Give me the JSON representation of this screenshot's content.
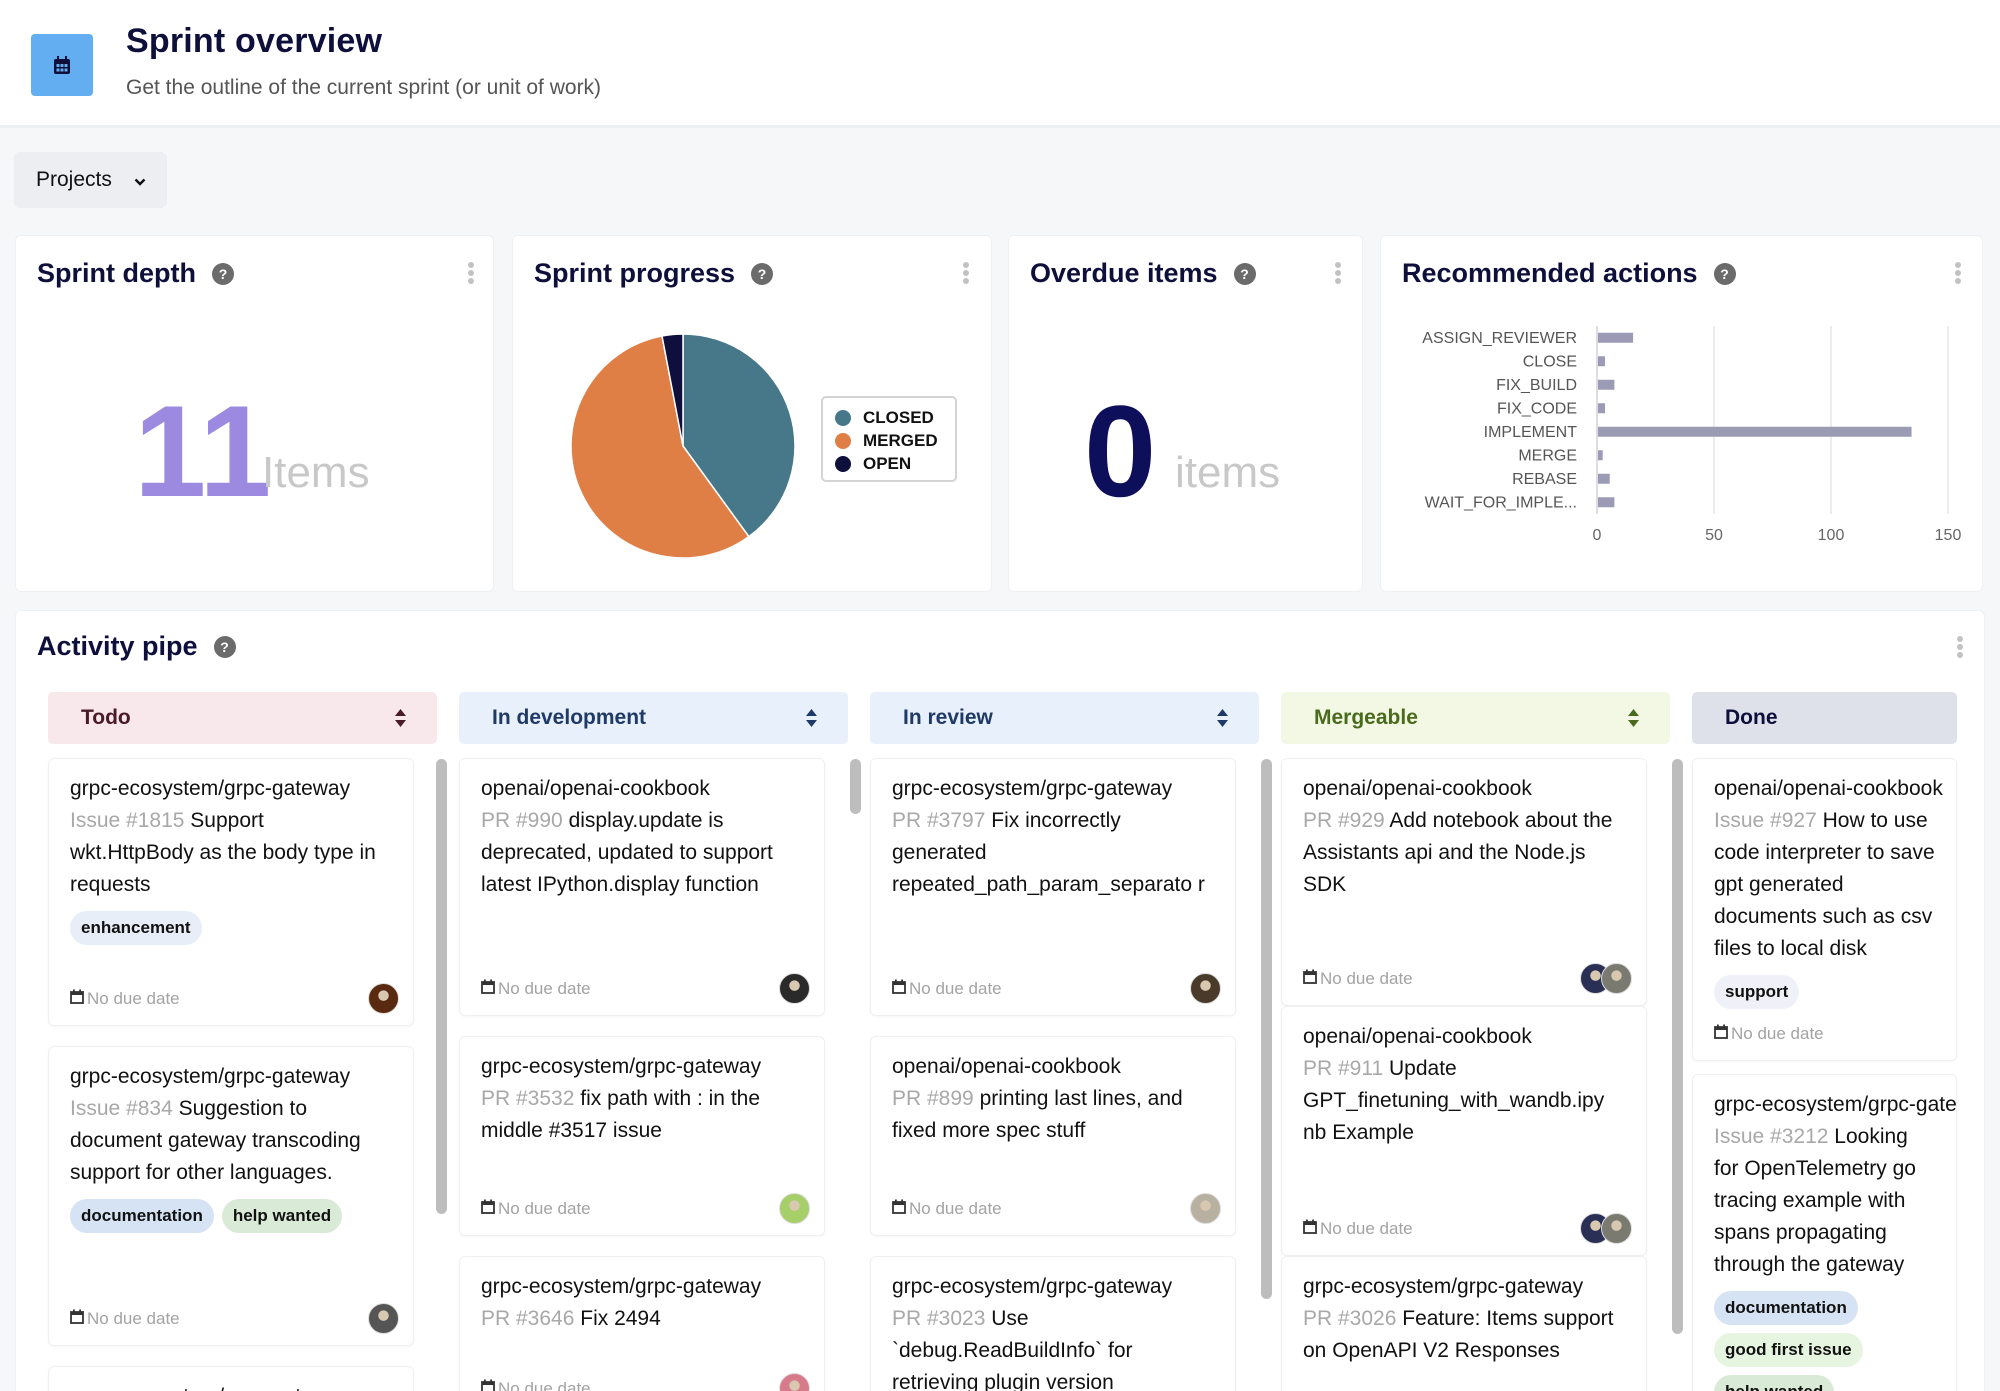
{
  "header": {
    "icon": "calendar-icon",
    "title": "Sprint overview",
    "subtitle": "Get the outline of the current sprint (or unit of work)"
  },
  "filters": {
    "projects_label": "Projects"
  },
  "widgets": {
    "sprint_depth": {
      "title": "Sprint depth",
      "value": "11",
      "unit": "Items"
    },
    "sprint_progress": {
      "title": "Sprint progress"
    },
    "overdue": {
      "title": "Overdue items",
      "value": "0",
      "unit": "items"
    },
    "recommended": {
      "title": "Recommended actions"
    }
  },
  "chart_data": [
    {
      "type": "pie",
      "title": "Sprint progress",
      "categories": [
        "CLOSED",
        "MERGED",
        "OPEN"
      ],
      "values": [
        40,
        57,
        3
      ],
      "colors": [
        "#46788a",
        "#e07f45",
        "#0e0f3a"
      ],
      "legend": "right"
    },
    {
      "type": "bar",
      "orientation": "horizontal",
      "title": "Recommended actions",
      "categories": [
        "ASSIGN_REVIEWER",
        "CLOSE",
        "FIX_BUILD",
        "FIX_CODE",
        "IMPLEMENT",
        "MERGE",
        "REBASE",
        "WAIT_FOR_IMPLE..."
      ],
      "values": [
        15,
        3,
        7,
        3,
        134,
        2,
        5,
        7
      ],
      "xticks": [
        "0",
        "50",
        "100",
        "150"
      ],
      "xlim": [
        0,
        150
      ],
      "grid": true,
      "color": "#9b9bb5"
    }
  ],
  "activity": {
    "title": "Activity pipe",
    "columns": [
      {
        "name": "Todo",
        "bg": "#f8e8ec",
        "fg": "#4a1a2a",
        "cards": [
          {
            "repo": "grpc-ecosystem/grpc-gateway",
            "ref": "Issue #1815",
            "title": "Support wkt.HttpBody as the body type in requests",
            "tags": [
              {
                "label": "enhancement",
                "bg": "#e8eef8"
              }
            ],
            "due": "No due date",
            "avatars": [
              "#5a2a10"
            ]
          },
          {
            "repo": "grpc-ecosystem/grpc-gateway",
            "ref": "Issue #834",
            "title": "Suggestion to document gateway transcoding support for other languages.",
            "tags": [
              {
                "label": "documentation",
                "bg": "#d6e3f5"
              },
              {
                "label": "help wanted",
                "bg": "#d9ebd6"
              }
            ],
            "due": "No due date",
            "avatars": [
              "#555555"
            ]
          },
          {
            "repo": "grpc-ecosystem/grpc-gateway",
            "ref": "",
            "title": "",
            "tags": [],
            "due": "",
            "avatars": []
          }
        ]
      },
      {
        "name": "In development",
        "bg": "#e8f0fb",
        "fg": "#1f3a66",
        "cards": [
          {
            "repo": "openai/openai-cookbook",
            "ref": "PR #990",
            "title": "display.update is deprecated, updated to support latest IPython.display function",
            "tags": [],
            "due": "No due date",
            "avatars": [
              "#2a2a2a"
            ]
          },
          {
            "repo": "grpc-ecosystem/grpc-gateway",
            "ref": "PR #3532",
            "title": "fix path with : in the middle #3517 issue",
            "tags": [],
            "due": "No due date",
            "avatars": [
              "#a6cf6a"
            ]
          },
          {
            "repo": "grpc-ecosystem/grpc-gateway",
            "ref": "PR #3646",
            "title": "Fix 2494",
            "tags": [],
            "due": "No due date",
            "avatars": [
              "#d77a8a"
            ]
          }
        ]
      },
      {
        "name": "In review",
        "bg": "#e8f0fb",
        "fg": "#1f3a66",
        "cards": [
          {
            "repo": "grpc-ecosystem/grpc-gateway",
            "ref": "PR #3797",
            "title": "Fix incorrectly generated repeated_path_param_separato r",
            "tags": [],
            "due": "No due date",
            "avatars": [
              "#4a3a2a"
            ]
          },
          {
            "repo": "openai/openai-cookbook",
            "ref": "PR #899",
            "title": "printing last lines, and fixed more spec stuff",
            "tags": [],
            "due": "No due date",
            "avatars": [
              "#b8b0a0"
            ]
          },
          {
            "repo": "grpc-ecosystem/grpc-gateway",
            "ref": "PR #3023",
            "title": "`debug.ReadBuildInfo` for retrieving plugin version",
            "title_prefix": "Use",
            "tags": [],
            "due": "",
            "avatars": []
          }
        ]
      },
      {
        "name": "Mergeable",
        "bg": "#f3f8e4",
        "fg": "#4a6a1e",
        "cards": [
          {
            "repo": "openai/openai-cookbook",
            "ref": "PR #929",
            "title": "Add notebook about the Assistants api and the Node.js SDK",
            "tags": [],
            "due": "No due date",
            "avatars": [
              "#2a2f55",
              "#7a7a70"
            ]
          },
          {
            "repo": "openai/openai-cookbook",
            "ref": "PR #911",
            "title": "Update GPT_finetuning_with_wandb.ipy nb Example",
            "tags": [],
            "due": "No due date",
            "avatars": [
              "#2a2f55",
              "#7a7a70"
            ]
          },
          {
            "repo": "grpc-ecosystem/grpc-gateway",
            "ref": "PR #3026",
            "title": "Feature: Items support on OpenAPI V2 Responses",
            "tags": [],
            "due": "",
            "avatars": []
          }
        ]
      },
      {
        "name": "Done",
        "bg": "#dfe1ea",
        "fg": "#0e0f3a",
        "cards": [
          {
            "repo": "openai/openai-cookbook",
            "ref": "Issue #927",
            "title": "How to use code interpreter to save gpt generated documents such as csv files to local disk",
            "tags": [
              {
                "label": "support",
                "bg": "#f0f0f8"
              }
            ],
            "due": "No due date",
            "avatars": []
          },
          {
            "repo": "grpc-ecosystem/grpc-gateway",
            "ref": "Issue #3212",
            "title": "Looking for OpenTelemetry go tracing example with spans propagating through the gateway",
            "tags": [
              {
                "label": "documentation",
                "bg": "#d6e3f5"
              },
              {
                "label": "good first issue",
                "bg": "#e6f5e0"
              },
              {
                "label": "help wanted",
                "bg": "#d9ebd6"
              }
            ],
            "due": "",
            "avatars": []
          }
        ]
      }
    ]
  }
}
